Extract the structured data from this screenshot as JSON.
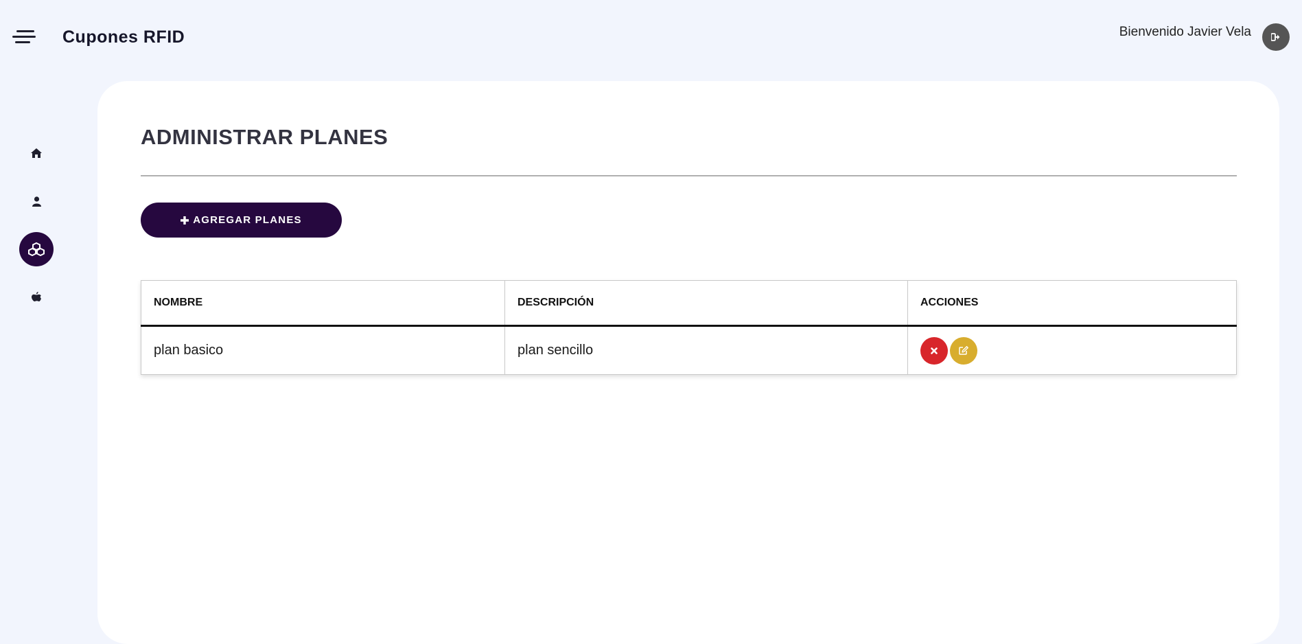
{
  "header": {
    "brand": "Cupones RFID",
    "welcome": "Bienvenido Javier Vela"
  },
  "sidebar": {
    "items": [
      {
        "name": "home",
        "icon": "home-icon",
        "active": false
      },
      {
        "name": "users",
        "icon": "user-icon",
        "active": false
      },
      {
        "name": "plans",
        "icon": "cubes-icon",
        "active": true
      },
      {
        "name": "apps",
        "icon": "apple-icon",
        "active": false
      }
    ]
  },
  "main": {
    "title": "ADMINISTRAR PLANES",
    "add_button": "AGREGAR PLANES",
    "table": {
      "headers": [
        "NOMBRE",
        "DESCRIPCIÓN",
        "ACCIONES"
      ],
      "rows": [
        {
          "nombre": "plan basico",
          "descripcion": "plan sencillo"
        }
      ]
    }
  },
  "colors": {
    "primary": "#26083f",
    "delete": "#d8262b",
    "edit": "#d8ad2e",
    "background": "#f2f5fd"
  }
}
